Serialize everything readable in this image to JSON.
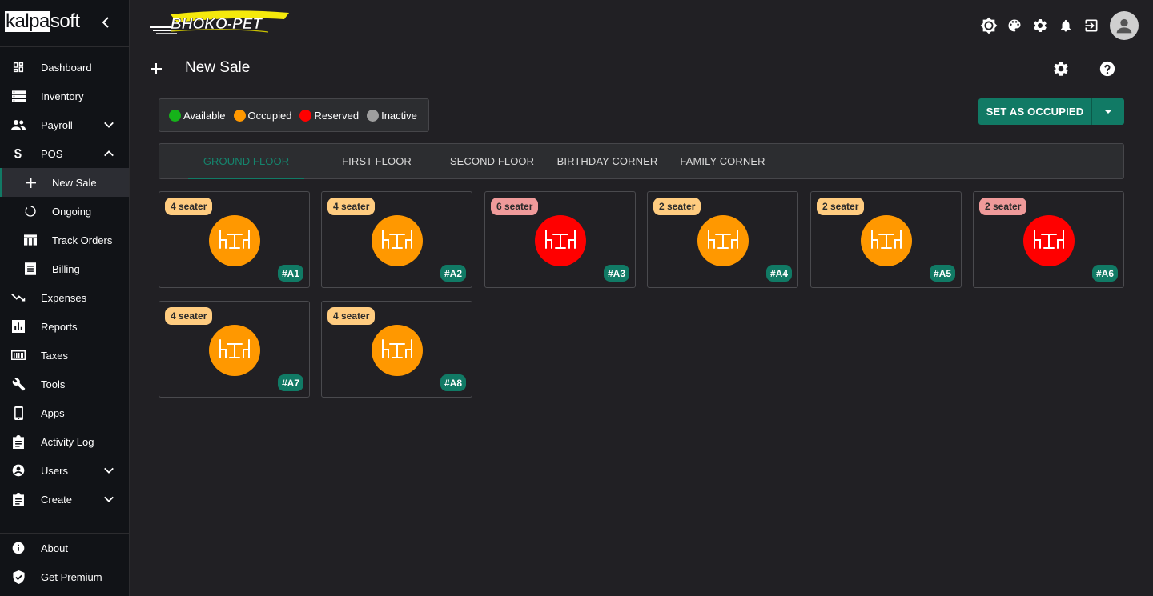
{
  "brand": {
    "boxed": "kalpa",
    "rest": "soft"
  },
  "logo": {
    "text": "BHOKO-PET"
  },
  "colors": {
    "accent": "#117a65",
    "available": "#16b31a",
    "occupied": "#ff9800",
    "reserved": "#ff0000",
    "inactive": "#9e9e9e",
    "seat_occupied_bg": "#ffcc80",
    "seat_reserved_bg": "#ef9a9a"
  },
  "sidebar": {
    "items": [
      {
        "label": "Dashboard",
        "icon": "dashboard-icon"
      },
      {
        "label": "Inventory",
        "icon": "list-icon"
      },
      {
        "label": "Payroll",
        "icon": "people-icon",
        "expand": "down"
      },
      {
        "label": "POS",
        "icon": "dollar-icon",
        "expand": "up"
      },
      {
        "label": "New Sale",
        "icon": "plus-icon",
        "sub": true,
        "active": true
      },
      {
        "label": "Ongoing",
        "icon": "progress-icon",
        "sub": true
      },
      {
        "label": "Track Orders",
        "icon": "table-icon",
        "sub": true
      },
      {
        "label": "Billing",
        "icon": "receipt-icon",
        "sub": true
      },
      {
        "label": "Expenses",
        "icon": "trending-down-icon"
      },
      {
        "label": "Reports",
        "icon": "chart-icon"
      },
      {
        "label": "Taxes",
        "icon": "calculator-icon"
      },
      {
        "label": "Tools",
        "icon": "wrench-icon"
      },
      {
        "label": "Apps",
        "icon": "phone-icon"
      },
      {
        "label": "Activity Log",
        "icon": "clipboard-icon"
      },
      {
        "label": "Users",
        "icon": "user-icon",
        "expand": "down"
      },
      {
        "label": "Create",
        "icon": "clipboard-icon",
        "expand": "down"
      }
    ],
    "bottom": [
      {
        "label": "About",
        "icon": "info-icon"
      },
      {
        "label": "Get Premium",
        "icon": "shield-check-icon"
      }
    ]
  },
  "topbar": {
    "icons": [
      "brightness-icon",
      "palette-icon",
      "gear-icon",
      "bell-icon",
      "logout-icon",
      "avatar-icon"
    ]
  },
  "page": {
    "title": "New Sale"
  },
  "legend": [
    {
      "label": "Available",
      "color": "#16b31a"
    },
    {
      "label": "Occupied",
      "color": "#ff9800"
    },
    {
      "label": "Reserved",
      "color": "#ff0000"
    },
    {
      "label": "Inactive",
      "color": "#9e9e9e"
    }
  ],
  "actions": {
    "set_occupied_label": "SET AS OCCUPIED"
  },
  "tabs": [
    {
      "label": "GROUND FLOOR",
      "active": true
    },
    {
      "label": "FIRST FLOOR"
    },
    {
      "label": "SECOND FLOOR"
    },
    {
      "label": "BIRTHDAY CORNER"
    },
    {
      "label": "FAMILY CORNER"
    }
  ],
  "tables": [
    {
      "id": "#A1",
      "seats": "4 seater",
      "status": "occupied"
    },
    {
      "id": "#A2",
      "seats": "4 seater",
      "status": "occupied"
    },
    {
      "id": "#A3",
      "seats": "6 seater",
      "status": "reserved"
    },
    {
      "id": "#A4",
      "seats": "2 seater",
      "status": "occupied"
    },
    {
      "id": "#A5",
      "seats": "2 seater",
      "status": "occupied"
    },
    {
      "id": "#A6",
      "seats": "2 seater",
      "status": "reserved"
    },
    {
      "id": "#A7",
      "seats": "4 seater",
      "status": "occupied"
    },
    {
      "id": "#A8",
      "seats": "4 seater",
      "status": "occupied"
    }
  ]
}
